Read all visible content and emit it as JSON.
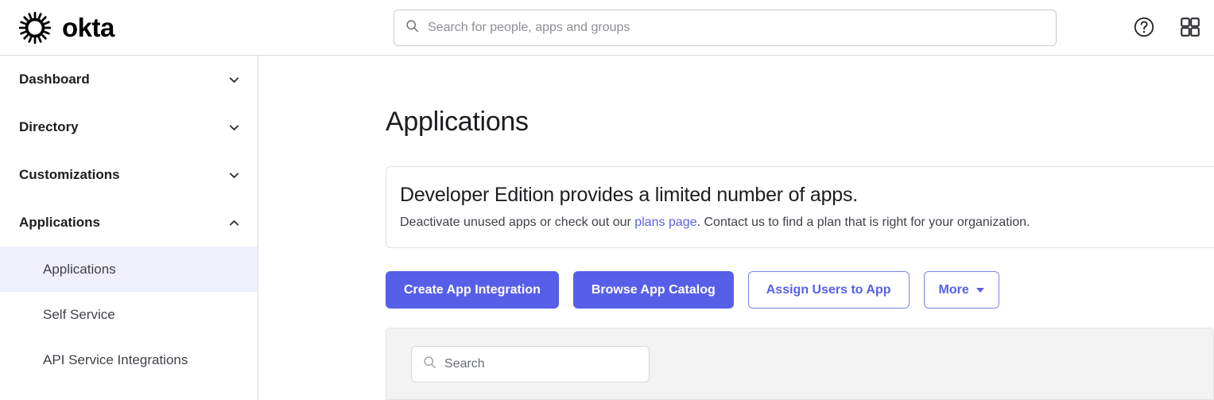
{
  "header": {
    "brand_name": "okta",
    "brand_icon": "okta-sunburst-logo",
    "search": {
      "icon": "search-icon",
      "placeholder": "Search for people, apps and groups",
      "value": ""
    },
    "help_icon": "question-circle-icon",
    "apps_grid_icon": "grid-apps-icon"
  },
  "sidebar": {
    "groups": [
      {
        "label": "Dashboard",
        "icon": "chevron-down-icon",
        "expanded": false
      },
      {
        "label": "Directory",
        "icon": "chevron-down-icon",
        "expanded": false
      },
      {
        "label": "Customizations",
        "icon": "chevron-down-icon",
        "expanded": false
      },
      {
        "label": "Applications",
        "icon": "chevron-up-icon",
        "expanded": true
      }
    ],
    "sub_items": [
      {
        "label": "Applications",
        "selected": true
      },
      {
        "label": "Self Service",
        "selected": false
      },
      {
        "label": "API Service Integrations",
        "selected": false
      }
    ],
    "selected_bg": "#eef0fb"
  },
  "main": {
    "page_title": "Applications",
    "notice": {
      "title": "Developer Edition provides a limited number of apps.",
      "body_before_link": "Deactivate unused apps or check out our ",
      "link_text": "plans page",
      "body_after_link": ". Contact us to find a plan that is right for your organization.",
      "link_color": "#5d61e6"
    },
    "buttons": [
      {
        "label": "Create App Integration",
        "style": "primary"
      },
      {
        "label": "Browse App Catalog",
        "style": "primary"
      },
      {
        "label": "Assign Users to App",
        "style": "secondary"
      },
      {
        "label": "More",
        "style": "secondary",
        "icon": "caret-down-icon"
      }
    ],
    "table_panel": {
      "search": {
        "icon": "search-icon",
        "placeholder": "Search",
        "value": ""
      },
      "background": "#f3f3f4"
    },
    "accent_color": "#575fe8"
  }
}
